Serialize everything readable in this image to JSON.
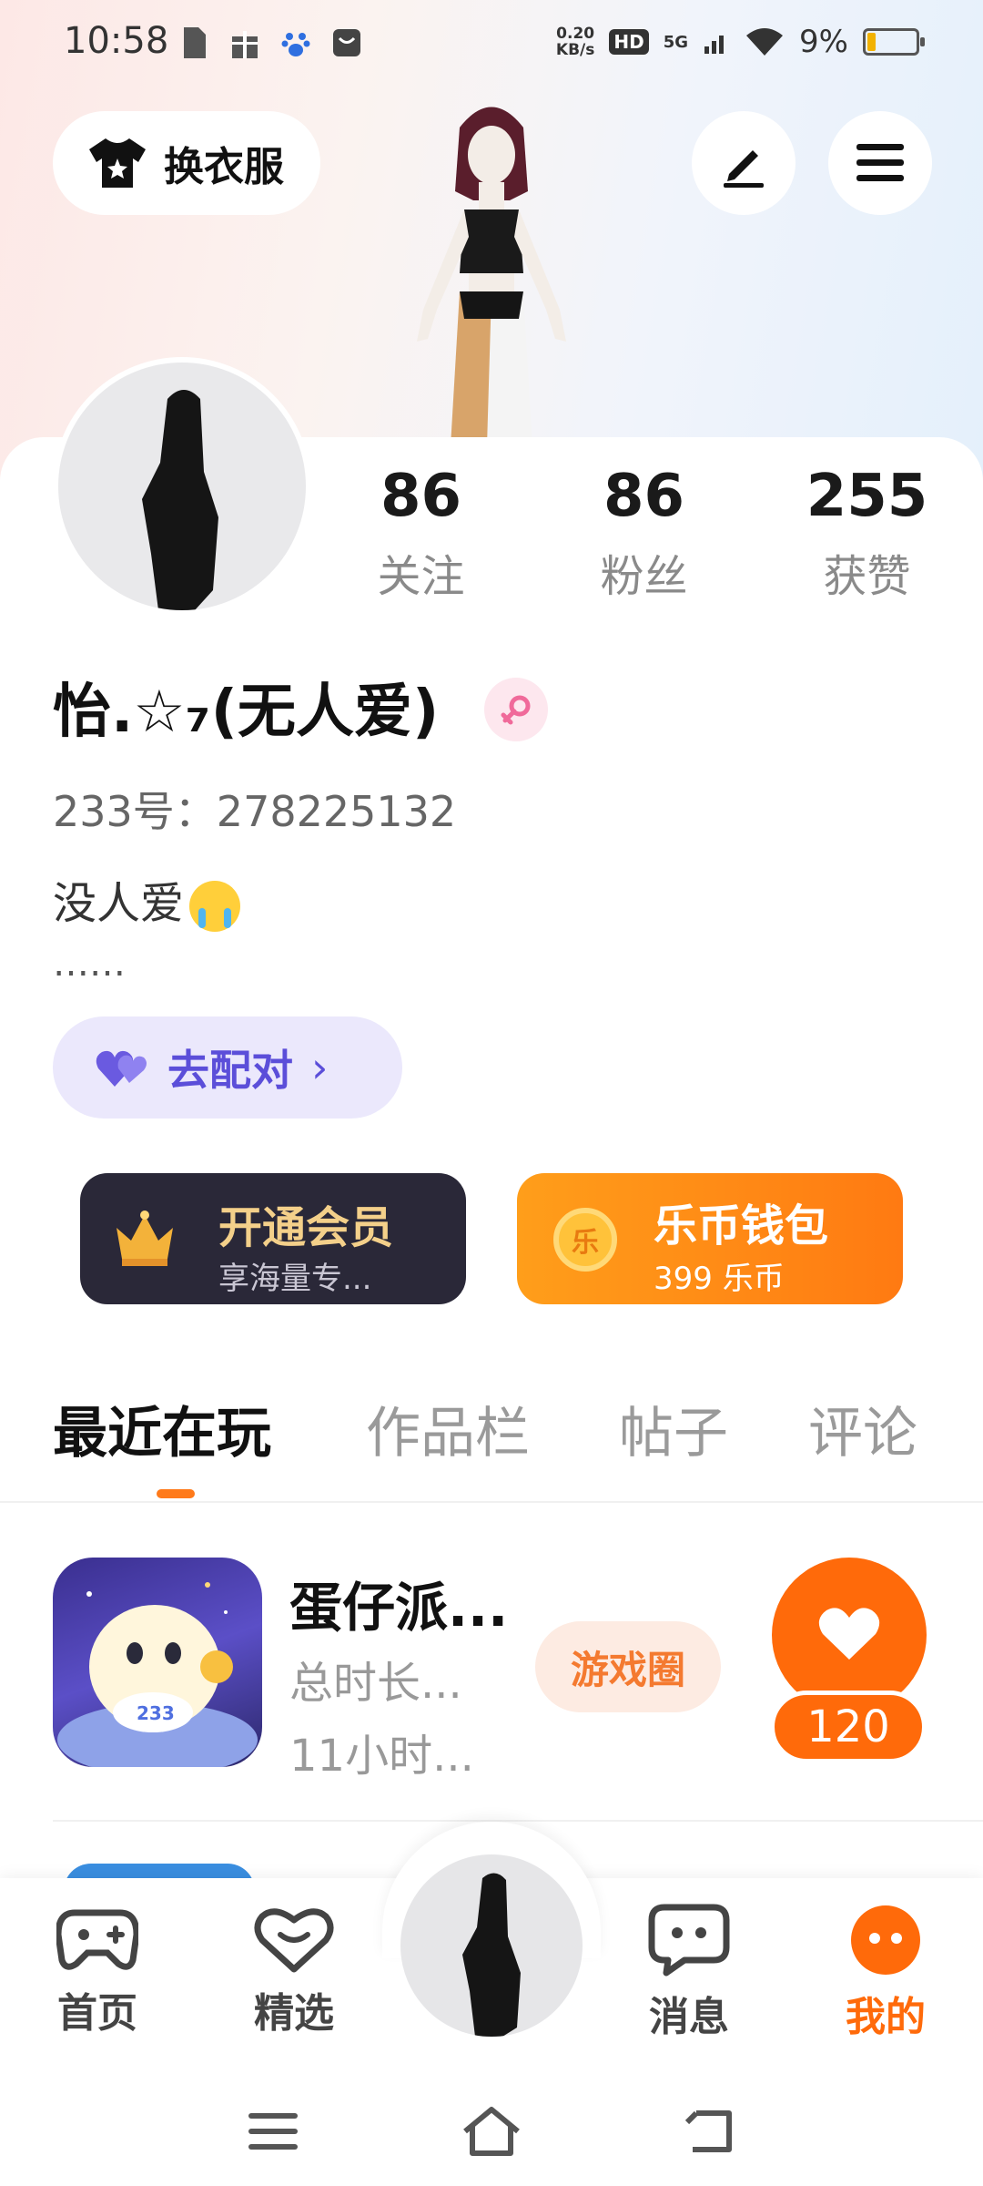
{
  "status_bar": {
    "time": "10:58",
    "network_speed_value": "0.20",
    "network_speed_unit": "KB/s",
    "hd_label": "HD",
    "network_type": "5G",
    "battery_percent": "9%"
  },
  "header": {
    "outfit_button_label": "换衣服"
  },
  "profile": {
    "stats": [
      {
        "value": "86",
        "label": "关注"
      },
      {
        "value": "86",
        "label": "粉丝"
      },
      {
        "value": "255",
        "label": "获赞"
      }
    ],
    "nickname": "怡.☆₇(无人爱)",
    "uid": "233号：278225132",
    "bio": "没人爱",
    "bio_more": "……",
    "match_button_label": "去配对",
    "match_chevron": "›"
  },
  "cards": {
    "vip": {
      "title": "开通会员",
      "subtitle": "享海量专..."
    },
    "wallet": {
      "title": "乐币钱包",
      "subtitle": "399 乐币",
      "coin_glyph": "乐"
    }
  },
  "tabs": [
    {
      "label": "最近在玩",
      "active": true
    },
    {
      "label": "作品栏",
      "active": false
    },
    {
      "label": "帖子",
      "active": false
    },
    {
      "label": "评论",
      "active": false
    }
  ],
  "recent_games": [
    {
      "name": "蛋仔派...",
      "meta_total": "总时长...",
      "meta_hours": "11小时...",
      "circle_button": "游戏圈",
      "like_count": "120"
    }
  ],
  "bottom_nav": {
    "items": [
      {
        "label": "首页",
        "icon": "gamepad-icon"
      },
      {
        "label": "精选",
        "icon": "heart-chat-icon"
      },
      {
        "label": "消息",
        "icon": "message-icon"
      },
      {
        "label": "我的",
        "icon": "me-icon",
        "active": true
      }
    ]
  },
  "colors": {
    "accent": "#ff6a0a",
    "match_purple": "#5b4ed9",
    "vip_gold": "#f4d08a"
  }
}
